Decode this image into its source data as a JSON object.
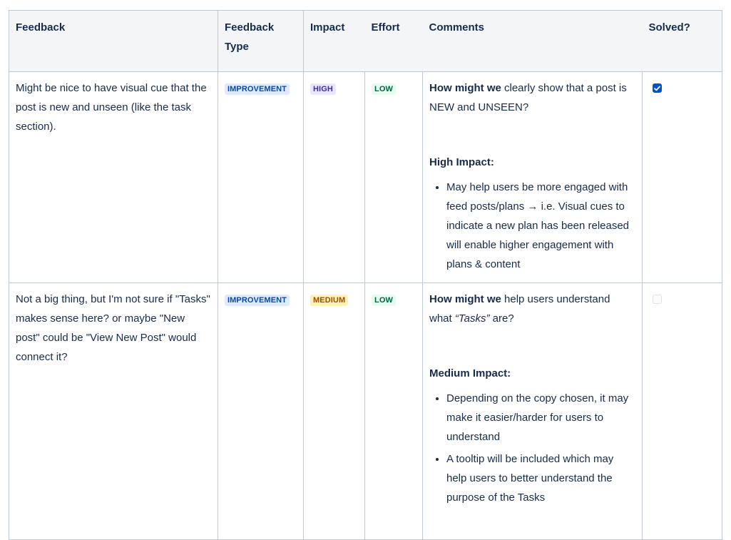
{
  "table": {
    "headers": {
      "feedback": "Feedback",
      "feedback_type": "Feedback Type",
      "impact": "Impact",
      "effort": "Effort",
      "comments": "Comments",
      "solved": "Solved?"
    },
    "rows": [
      {
        "feedback": "Might be nice to have visual cue that the post is new and unseen (like the task section).",
        "type": "IMPROVEMENT",
        "impact": "HIGH",
        "effort": "LOW",
        "comment_bold": "How might we",
        "comment_rest": " clearly show that a post is NEW and UNSEEN?",
        "impact_title": "High Impact:",
        "bullets": [
          "May help users be more engaged with feed posts/plans → i.e. Visual cues to indicate a new plan has been released will enable higher engagement with plans & content"
        ],
        "solved": true
      },
      {
        "feedback": "Not a big thing, but I'm not sure if \"Tasks\" makes sense here? or maybe \"New post\" could be \"View New Post\" would connect it?",
        "type": "IMPROVEMENT",
        "impact": "MEDIUM",
        "effort": "LOW",
        "comment_bold": "How might we",
        "comment_rest": " help users understand what ",
        "comment_em": "“Tasks”",
        "comment_tail": " are?",
        "impact_title": "Medium Impact:",
        "bullets": [
          "Depending on the copy chosen, it may make it easier/harder for users to understand",
          "A tooltip will be included which may help users to better understand the purpose of the Tasks"
        ],
        "solved": false
      }
    ]
  },
  "colors": {
    "text": "#172b4d",
    "header_bg": "#f4f5f7",
    "border": "#c1c7d0",
    "checkbox_checked": "#0052cc"
  }
}
